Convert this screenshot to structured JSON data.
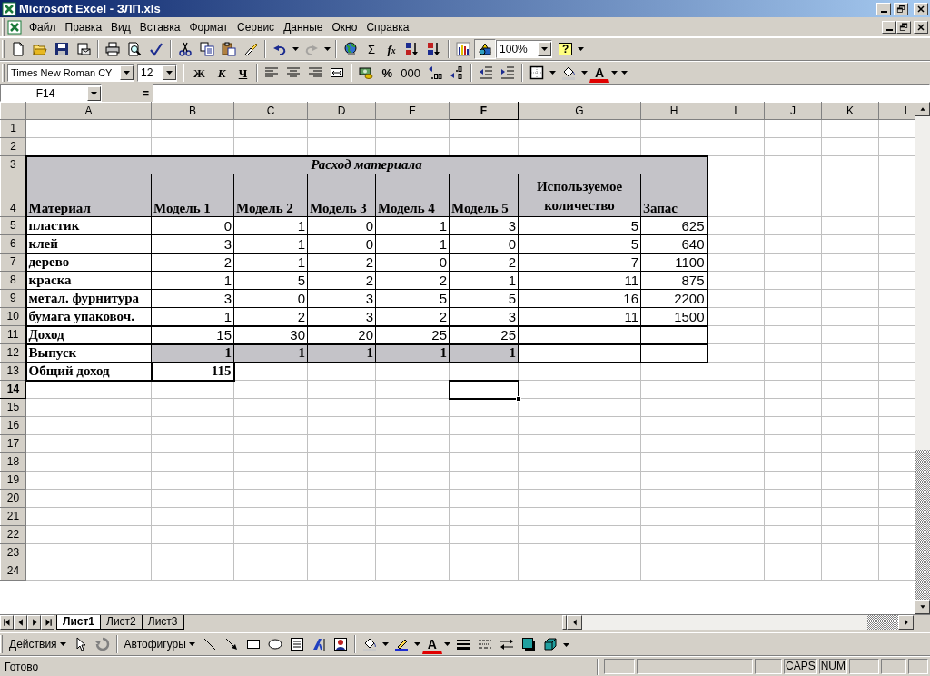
{
  "window": {
    "title": "Microsoft Excel - ЗЛП.xls"
  },
  "menu": [
    "Файл",
    "Правка",
    "Вид",
    "Вставка",
    "Формат",
    "Сервис",
    "Данные",
    "Окно",
    "Справка"
  ],
  "standard_toolbar": {
    "autosum": "Σ",
    "function": "f$_{x}$",
    "zoom": "100%",
    "help": "?",
    "redo": {
      "disabled": true
    },
    "drawing": {
      "pressed": true
    }
  },
  "formatting_toolbar": {
    "font": "Times New Roman CY",
    "size": "12",
    "bold": "Ж",
    "italic": "К",
    "underline": "Ч",
    "percent": "%",
    "thousands": "000",
    "font_color": "A"
  },
  "formula_bar": {
    "name_box": "F14",
    "equals": "="
  },
  "columns": [
    {
      "label": "A",
      "selected": false
    },
    {
      "label": "B",
      "selected": false
    },
    {
      "label": "C",
      "selected": false
    },
    {
      "label": "D",
      "selected": false
    },
    {
      "label": "E",
      "selected": false
    },
    {
      "label": "F",
      "selected": true
    },
    {
      "label": "G",
      "selected": false
    },
    {
      "label": "H",
      "selected": false
    },
    {
      "label": "I",
      "selected": false
    },
    {
      "label": "J",
      "selected": false
    },
    {
      "label": "K",
      "selected": false
    },
    {
      "label": "L",
      "selected": false
    }
  ],
  "rows": [
    {
      "label": "1",
      "selected": false,
      "kind": "plain"
    },
    {
      "label": "2",
      "selected": false,
      "kind": "plain"
    },
    {
      "label": "3",
      "selected": false,
      "kind": "title",
      "cells": [
        {
          "text": "Расход материала"
        }
      ]
    },
    {
      "label": "4",
      "selected": false,
      "kind": "header",
      "cells": [
        {
          "text": "Материал"
        },
        {
          "text": "Модель 1"
        },
        {
          "text": "Модель 2"
        },
        {
          "text": "Модель 3"
        },
        {
          "text": "Модель 4"
        },
        {
          "text": "Модель 5"
        },
        {
          "text": "Используемое количество",
          "wrap": true
        },
        {
          "text": "Запас"
        }
      ]
    },
    {
      "label": "5",
      "selected": false,
      "kind": "data",
      "cells": [
        {
          "text": "пластик"
        },
        {
          "text": "0"
        },
        {
          "text": "1"
        },
        {
          "text": "0"
        },
        {
          "text": "1"
        },
        {
          "text": "3"
        },
        {
          "text": "5"
        },
        {
          "text": "625"
        }
      ]
    },
    {
      "label": "6",
      "selected": false,
      "kind": "data",
      "cells": [
        {
          "text": "клей"
        },
        {
          "text": "3"
        },
        {
          "text": "1"
        },
        {
          "text": "0"
        },
        {
          "text": "1"
        },
        {
          "text": "0"
        },
        {
          "text": "5"
        },
        {
          "text": "640"
        }
      ]
    },
    {
      "label": "7",
      "selected": false,
      "kind": "data",
      "cells": [
        {
          "text": "дерево"
        },
        {
          "text": "2"
        },
        {
          "text": "1"
        },
        {
          "text": "2"
        },
        {
          "text": "0"
        },
        {
          "text": "2"
        },
        {
          "text": "7"
        },
        {
          "text": "1100"
        }
      ]
    },
    {
      "label": "8",
      "selected": false,
      "kind": "data",
      "cells": [
        {
          "text": "краска"
        },
        {
          "text": "1"
        },
        {
          "text": "5"
        },
        {
          "text": "2"
        },
        {
          "text": "2"
        },
        {
          "text": "1"
        },
        {
          "text": "11"
        },
        {
          "text": "875"
        }
      ]
    },
    {
      "label": "9",
      "selected": false,
      "kind": "data",
      "cells": [
        {
          "text": "метал. фурнитура"
        },
        {
          "text": "3"
        },
        {
          "text": "0"
        },
        {
          "text": "3"
        },
        {
          "text": "5"
        },
        {
          "text": "5"
        },
        {
          "text": "16"
        },
        {
          "text": "2200"
        }
      ]
    },
    {
      "label": "10",
      "selected": false,
      "kind": "data",
      "cells": [
        {
          "text": "бумага упаковоч."
        },
        {
          "text": "1"
        },
        {
          "text": "2"
        },
        {
          "text": "3"
        },
        {
          "text": "2"
        },
        {
          "text": "3"
        },
        {
          "text": "11"
        },
        {
          "text": "1500"
        }
      ]
    },
    {
      "label": "11",
      "selected": false,
      "kind": "income",
      "cells": [
        {
          "text": "Доход"
        },
        {
          "text": "15"
        },
        {
          "text": "30"
        },
        {
          "text": "20"
        },
        {
          "text": "25"
        },
        {
          "text": "25"
        }
      ]
    },
    {
      "label": "12",
      "selected": false,
      "kind": "output",
      "cells": [
        {
          "text": "Выпуск"
        },
        {
          "text": "1"
        },
        {
          "text": "1"
        },
        {
          "text": "1"
        },
        {
          "text": "1"
        },
        {
          "text": "1"
        }
      ]
    },
    {
      "label": "13",
      "selected": false,
      "kind": "total",
      "cells": [
        {
          "text": "Общий доход"
        },
        {
          "text": "115"
        }
      ]
    },
    {
      "label": "14",
      "selected": true,
      "kind": "plain"
    },
    {
      "label": "15",
      "selected": false,
      "kind": "plain"
    },
    {
      "label": "16",
      "selected": false,
      "kind": "plain"
    },
    {
      "label": "17",
      "selected": false,
      "kind": "plain"
    },
    {
      "label": "18",
      "selected": false,
      "kind": "plain"
    },
    {
      "label": "19",
      "selected": false,
      "kind": "plain"
    },
    {
      "label": "20",
      "selected": false,
      "kind": "plain"
    },
    {
      "label": "21",
      "selected": false,
      "kind": "plain"
    },
    {
      "label": "22",
      "selected": false,
      "kind": "plain"
    },
    {
      "label": "23",
      "selected": false,
      "kind": "plain"
    },
    {
      "label": "24",
      "selected": false,
      "kind": "plain"
    }
  ],
  "sheet_tabs": [
    {
      "label": "Лист1",
      "selected": true
    },
    {
      "label": "Лист2",
      "selected": false
    },
    {
      "label": "Лист3",
      "selected": false
    }
  ],
  "drawing_toolbar": {
    "actions": "Действия",
    "autoshapes": "Автофигуры",
    "font_color": "A"
  },
  "status_bar": {
    "text": "Готово",
    "indicators": [
      "CAPS",
      "NUM"
    ]
  }
}
